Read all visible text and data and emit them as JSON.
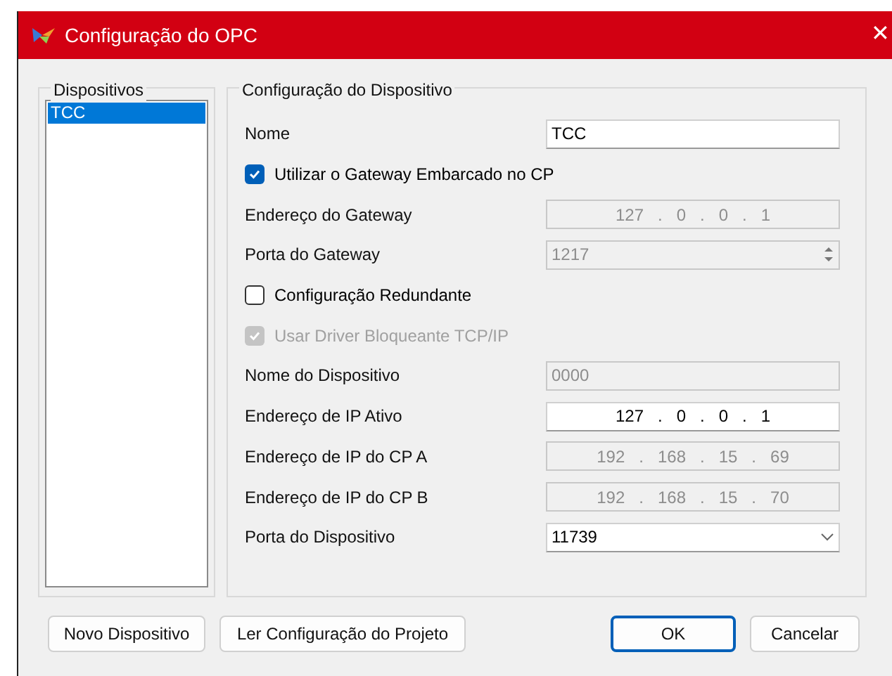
{
  "window": {
    "title": "Configuração do OPC",
    "close": "✕"
  },
  "devices": {
    "title": "Dispositivos",
    "items": [
      {
        "label": "TCC",
        "selected": true
      }
    ]
  },
  "config": {
    "title": "Configuração do Dispositivo",
    "ip_separator": ".",
    "rows": [
      {
        "kind": "text",
        "label": "Nome",
        "value": "TCC",
        "disabled": false
      },
      {
        "kind": "checkbox",
        "label": "Utilizar o Gateway Embarcado no CP",
        "checked": true,
        "disabled": false
      },
      {
        "kind": "ip",
        "label": "Endereço do Gateway",
        "octets": [
          "127",
          "0",
          "0",
          "1"
        ],
        "disabled": true
      },
      {
        "kind": "spin",
        "label": "Porta do Gateway",
        "value": "1217",
        "disabled": true
      },
      {
        "kind": "checkbox",
        "label": "Configuração Redundante",
        "checked": false,
        "disabled": false
      },
      {
        "kind": "checkbox",
        "label": "Usar Driver Bloqueante TCP/IP",
        "checked": true,
        "disabled": true
      },
      {
        "kind": "text",
        "label": "Nome do Dispositivo",
        "value": "0000",
        "disabled": true
      },
      {
        "kind": "ip",
        "label": "Endereço de IP Ativo",
        "octets": [
          "127",
          "0",
          "0",
          "1"
        ],
        "disabled": false
      },
      {
        "kind": "ip",
        "label": "Endereço de IP do CP A",
        "octets": [
          "192",
          "168",
          "15",
          "69"
        ],
        "disabled": true
      },
      {
        "kind": "ip",
        "label": "Endereço de IP do CP B",
        "octets": [
          "192",
          "168",
          "15",
          "70"
        ],
        "disabled": true
      },
      {
        "kind": "combo",
        "label": "Porta do Dispositivo",
        "value": "11739",
        "disabled": false
      }
    ]
  },
  "buttons": [
    {
      "label": "Novo Dispositivo",
      "default": false
    },
    {
      "label": "Ler Configuração do Projeto",
      "default": false
    },
    {
      "label": "OK",
      "default": true
    },
    {
      "label": "Cancelar",
      "default": false
    }
  ]
}
